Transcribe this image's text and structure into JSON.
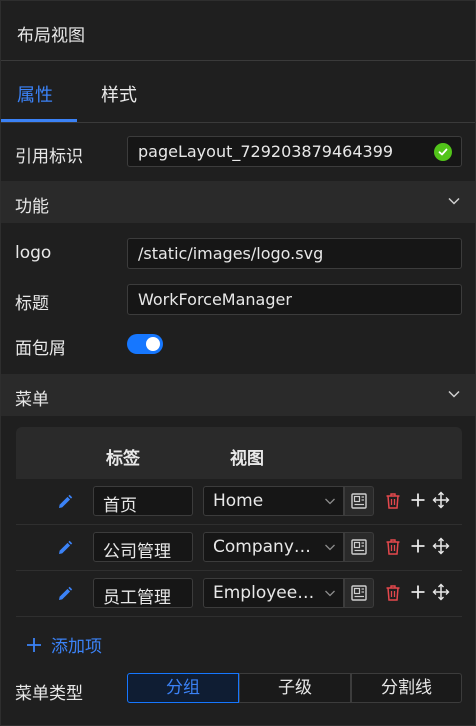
{
  "panel": {
    "title": "布局视图"
  },
  "tabs": [
    {
      "label": "属性",
      "active": true
    },
    {
      "label": "样式",
      "active": false
    }
  ],
  "reference": {
    "label": "引用标识",
    "value": "pageLayout_729203879464399",
    "status_color": "#52c41a"
  },
  "sections": {
    "function": {
      "label": "功能",
      "expanded": true
    },
    "menu": {
      "label": "菜单",
      "expanded": true
    }
  },
  "fields": {
    "logo": {
      "label": "logo",
      "value": "/static/images/logo.svg"
    },
    "title": {
      "label": "标题",
      "value": "WorkForceManager"
    },
    "breadcrumb": {
      "label": "面包屑",
      "enabled": true
    }
  },
  "menu_table": {
    "columns": [
      "标签",
      "视图"
    ],
    "rows": [
      {
        "label": "首页",
        "view": "Home"
      },
      {
        "label": "公司管理",
        "view": "CompanyL..."
      },
      {
        "label": "员工管理",
        "view": "Employee_..."
      }
    ],
    "add_label": "添加项"
  },
  "menu_type": {
    "label": "菜单类型",
    "options": [
      "分组",
      "子级",
      "分割线"
    ],
    "selected": "分组"
  },
  "colors": {
    "accent": "#3b82f6",
    "danger": "#e5484d",
    "background": "#1f1f1f"
  }
}
